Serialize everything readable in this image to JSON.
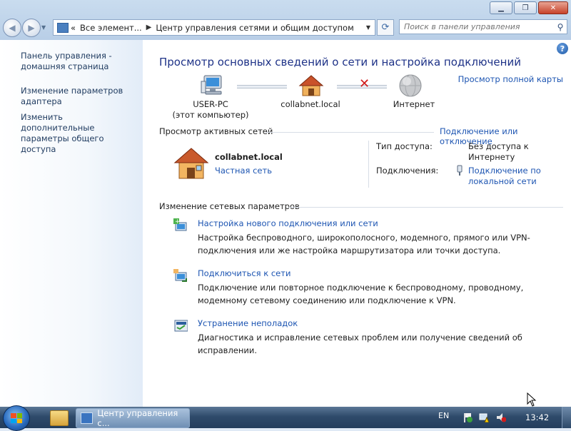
{
  "window": {
    "caption_buttons": [
      "minimize",
      "maximize",
      "close"
    ]
  },
  "nav": {
    "breadcrumb": [
      "Все элемент...",
      "Центр управления сетями и общим доступом"
    ],
    "breadcrumb_sep": "«",
    "search_placeholder": "Поиск в панели управления"
  },
  "sidebar": {
    "items": [
      "Панель управления - домашняя страница",
      "Изменение параметров адаптера",
      "Изменить дополнительные параметры общего доступа"
    ]
  },
  "main": {
    "heading": "Просмотр основных сведений о сети и настройка подключений",
    "full_map_link": "Просмотр полной карты",
    "map": {
      "computer_name": "USER-PC",
      "computer_sub": "(этот компьютер)",
      "network_name": "collabnet.local",
      "internet_label": "Интернет"
    },
    "active_networks": {
      "title": "Просмотр активных сетей",
      "connect_link": "Подключение или отключение",
      "network_name": "collabnet.local",
      "network_type": "Частная сеть",
      "access_type_label": "Тип доступа:",
      "access_type_value": "Без доступа к Интернету",
      "connections_label": "Подключения:",
      "connections_value": "Подключение по локальной сети"
    },
    "change_settings": {
      "title": "Изменение сетевых параметров",
      "tasks": [
        {
          "link": "Настройка нового подключения или сети",
          "desc": "Настройка беспроводного, широкополосного, модемного, прямого или VPN-подключения или же настройка маршрутизатора или точки доступа."
        },
        {
          "link": "Подключиться к сети",
          "desc": "Подключение или повторное подключение к беспроводному, проводному, модемному сетевому соединению или подключение к VPN."
        },
        {
          "link": "Устранение неполадок",
          "desc": "Диагностика и исправление сетевых проблем или получение сведений об исправлении."
        }
      ]
    }
  },
  "taskbar": {
    "active_task": "Центр управления с...",
    "language": "EN",
    "clock": "13:42"
  }
}
